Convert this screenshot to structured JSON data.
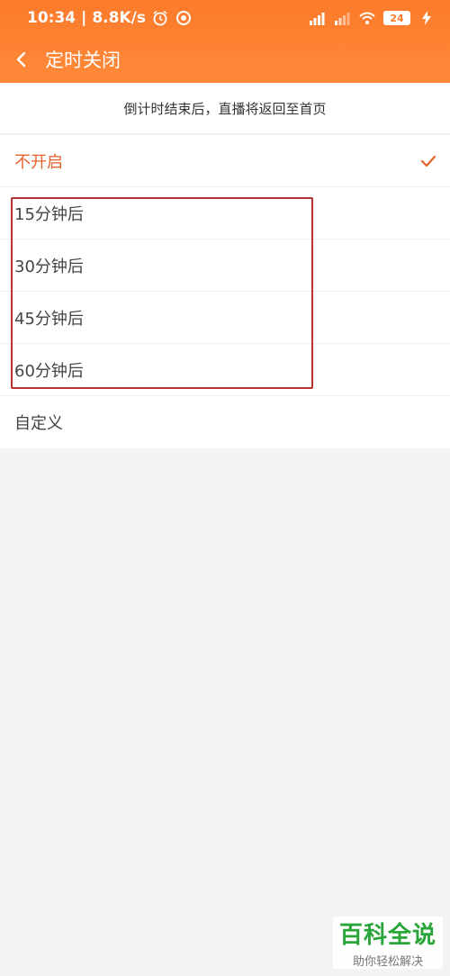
{
  "status_bar": {
    "time": "10:34",
    "speed": "8.8K/s",
    "battery": "24",
    "icons": [
      "alarm-icon",
      "sync-icon",
      "signal-icon",
      "signal-icon-2",
      "wifi-icon",
      "battery-icon",
      "charging-icon"
    ]
  },
  "header": {
    "title": "定时关闭"
  },
  "notice": "倒计时结束后，直播将返回至首页",
  "options": [
    {
      "label": "不开启",
      "selected": true
    },
    {
      "label": "15分钟后",
      "selected": false
    },
    {
      "label": "30分钟后",
      "selected": false
    },
    {
      "label": "45分钟后",
      "selected": false
    },
    {
      "label": "60分钟后",
      "selected": false
    },
    {
      "label": "自定义",
      "selected": false
    }
  ],
  "watermark": {
    "logo": "百科全说",
    "subtitle": "助你轻松解决"
  },
  "colors": {
    "header": "#fb7a2b",
    "accent": "#e9612a",
    "annotation": "#b83232",
    "watermark": "#2aa53a"
  }
}
